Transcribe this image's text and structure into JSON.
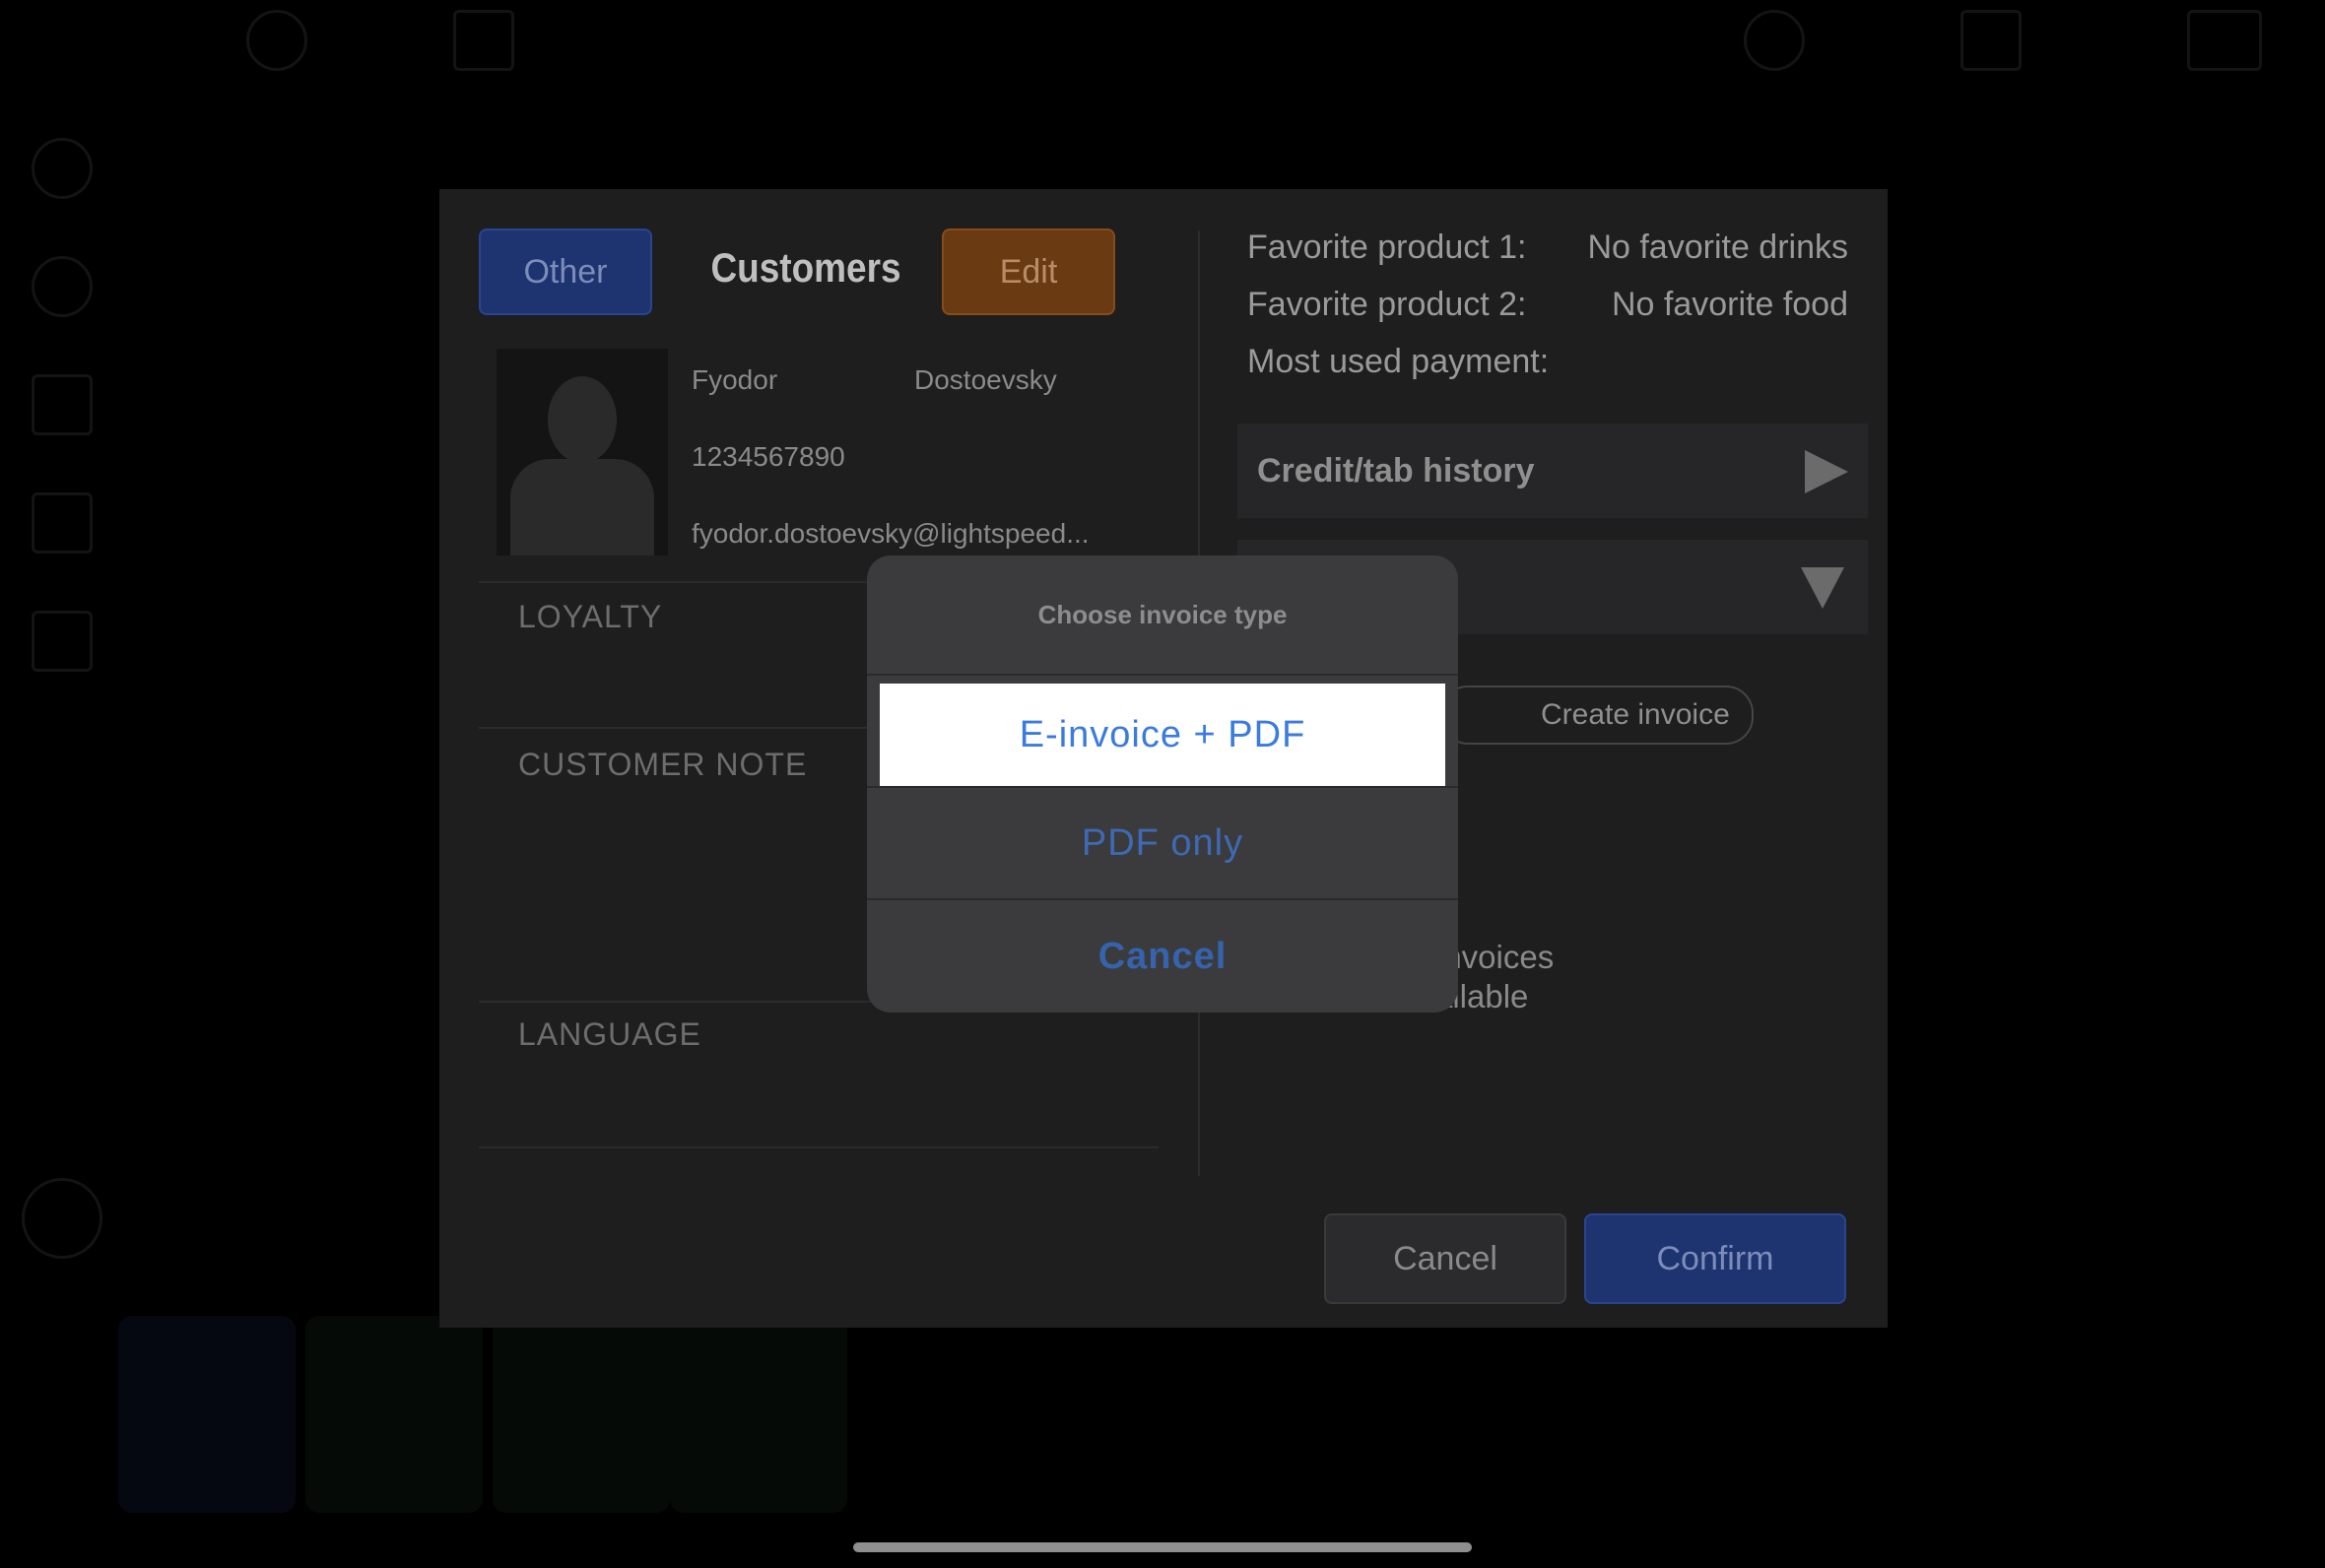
{
  "customers_modal": {
    "other_button": "Other",
    "title": "Customers",
    "edit_button": "Edit",
    "customer": {
      "first_name": "Fyodor",
      "last_name": "Dostoevsky",
      "phone": "1234567890",
      "email": "fyodor.dostoevsky@lightspeed..."
    },
    "sections": {
      "loyalty": "LOYALTY",
      "customer_note": "CUSTOMER NOTE",
      "language": "LANGUAGE"
    },
    "favorites": {
      "product1_label": "Favorite product 1:",
      "product1_value": "No favorite drinks",
      "product2_label": "Favorite product 2:",
      "product2_value": "No favorite food",
      "payment_label": "Most used payment:"
    },
    "credit_tab_history": "Credit/tab history",
    "create_invoice": "Create invoice",
    "no_invoices_line1": "invoices",
    "no_invoices_line2": "ailable",
    "cancel_button": "Cancel",
    "confirm_button": "Confirm"
  },
  "action_sheet": {
    "title": "Choose invoice type",
    "options": [
      "E-invoice + PDF",
      "PDF only"
    ],
    "cancel": "Cancel"
  },
  "colors": {
    "backdrop": "#000000",
    "modal_bg": "#1e1e1f",
    "sheet_bg": "#3b3b3d",
    "accent_blue": "#3a7be0",
    "highlight": "#ffffff"
  }
}
